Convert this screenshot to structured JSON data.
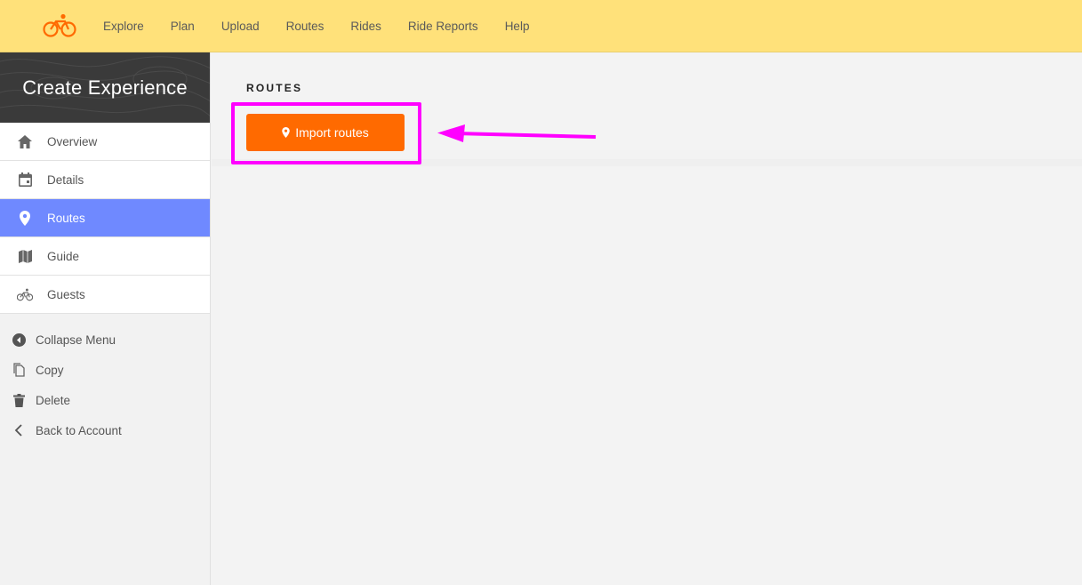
{
  "topnav": {
    "logo": "cyclist-logo",
    "items": [
      "Explore",
      "Plan",
      "Upload",
      "Routes",
      "Rides",
      "Ride Reports",
      "Help"
    ]
  },
  "sidebar": {
    "title": "Create Experience",
    "items": [
      {
        "label": "Overview",
        "icon": "home-icon"
      },
      {
        "label": "Details",
        "icon": "calendar-icon"
      },
      {
        "label": "Routes",
        "icon": "pin-icon",
        "active": true
      },
      {
        "label": "Guide",
        "icon": "map-icon"
      },
      {
        "label": "Guests",
        "icon": "bike-icon"
      }
    ],
    "actions": [
      {
        "label": "Collapse Menu",
        "icon": "collapse-icon"
      },
      {
        "label": "Copy",
        "icon": "copy-icon"
      },
      {
        "label": "Delete",
        "icon": "trash-icon"
      },
      {
        "label": "Back to Account",
        "icon": "chevron-left-icon"
      }
    ]
  },
  "main": {
    "section_title": "ROUTES",
    "import_button": "Import routes"
  },
  "colors": {
    "topbar": "#ffe17a",
    "active": "#6f89ff",
    "button": "#ff6a00",
    "highlight": "#ff00ff"
  }
}
